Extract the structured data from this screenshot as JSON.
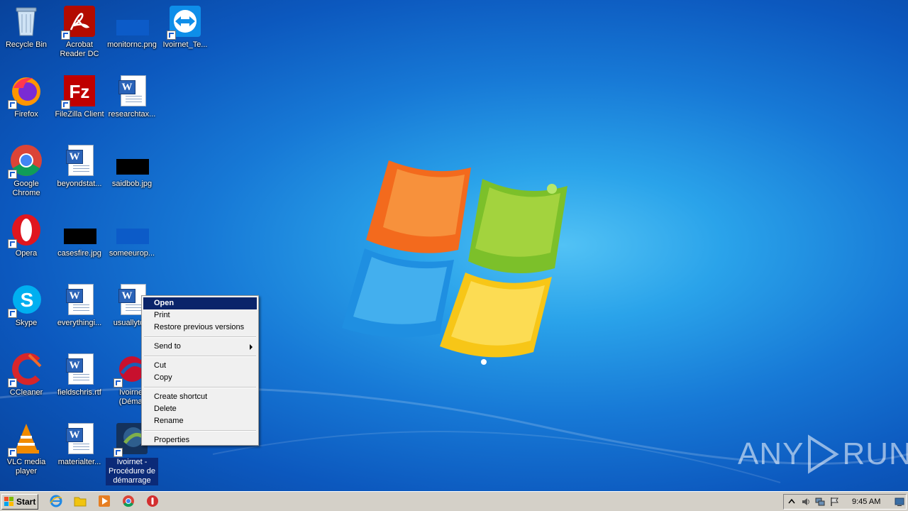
{
  "desktop": {
    "icons": [
      {
        "label": "Recycle Bin"
      },
      {
        "label": "Acrobat Reader DC"
      },
      {
        "label": "monitornc.png"
      },
      {
        "label": "Ivoirnet_Te..."
      },
      {
        "label": "Firefox"
      },
      {
        "label": "FileZilla Client"
      },
      {
        "label": "researchtax..."
      },
      {
        "label": "Google Chrome"
      },
      {
        "label": "beyondstat..."
      },
      {
        "label": "saidbob.jpg"
      },
      {
        "label": "Opera"
      },
      {
        "label": "casesfire.jpg"
      },
      {
        "label": "someeurop..."
      },
      {
        "label": "Skype"
      },
      {
        "label": "everythingi..."
      },
      {
        "label": "usuallyto..."
      },
      {
        "label": "CCleaner"
      },
      {
        "label": "fieldschris.rtf"
      },
      {
        "label": "Ivoirnet (Démar"
      },
      {
        "label": "VLC media player"
      },
      {
        "label": "materialter..."
      },
      {
        "label": "Ivoirnet - Procédure de démarrage"
      }
    ]
  },
  "context_menu": {
    "items": [
      {
        "label": "Open"
      },
      {
        "label": "Print"
      },
      {
        "label": "Restore previous versions"
      },
      {
        "label": "Send to"
      },
      {
        "label": "Cut"
      },
      {
        "label": "Copy"
      },
      {
        "label": "Create shortcut"
      },
      {
        "label": "Delete"
      },
      {
        "label": "Rename"
      },
      {
        "label": "Properties"
      }
    ]
  },
  "watermark": {
    "text_left": "ANY",
    "text_right": "RUN"
  },
  "taskbar": {
    "start_label": "Start",
    "quick_launch": [
      "internet-explorer-icon",
      "folder-icon",
      "media-player-icon",
      "chrome-icon",
      "stop-icon"
    ],
    "clock": "9:45 AM"
  },
  "colors": {
    "selection": "#0a246a",
    "taskbar": "#d4d0c8"
  }
}
